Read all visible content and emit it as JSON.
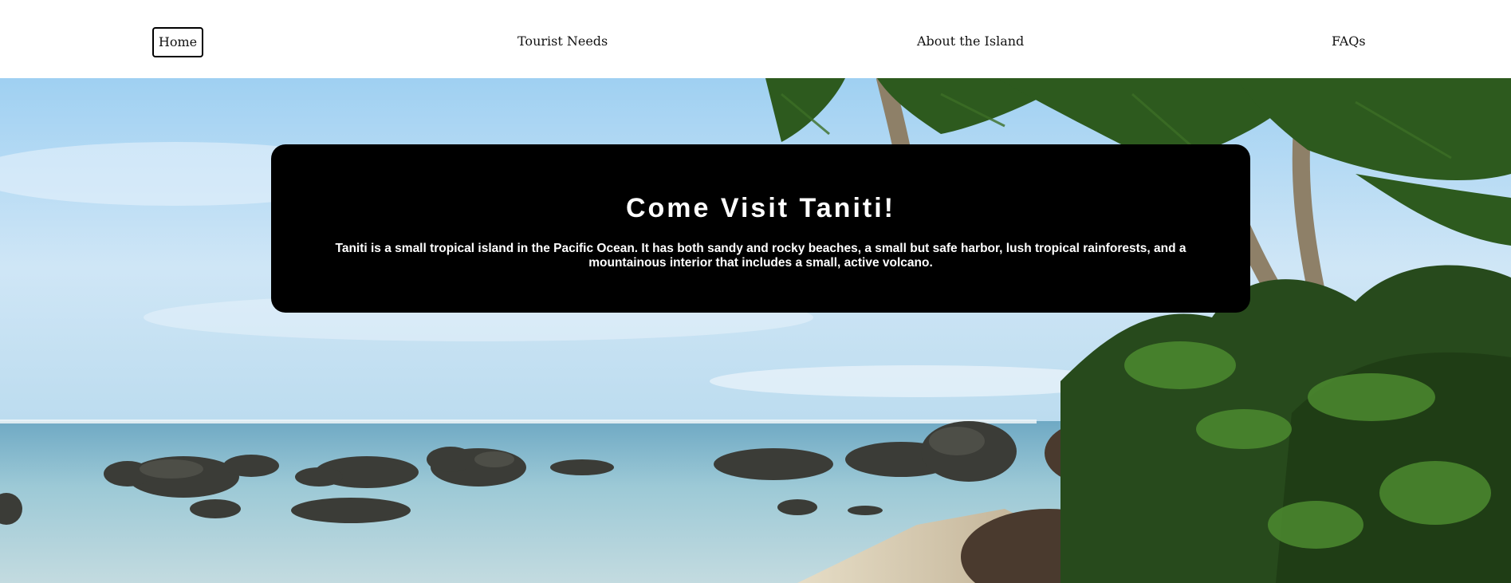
{
  "nav": {
    "home": "Home",
    "tourist_needs": "Tourist Needs",
    "about": "About the Island",
    "faqs": "FAQs"
  },
  "hero": {
    "title": "Come Visit Taniti!",
    "description": "Taniti is a small tropical island in the Pacific Ocean. It has both sandy and rocky beaches, a small but safe harbor, lush tropical rainforests, and a mountainous interior that includes a small, active volcano."
  },
  "colors": {
    "sky": "#bfe0f7",
    "sea": "#8fc4d8",
    "rock": "#3a3a36",
    "foliage": "#2f5a22",
    "box": "#000000"
  }
}
